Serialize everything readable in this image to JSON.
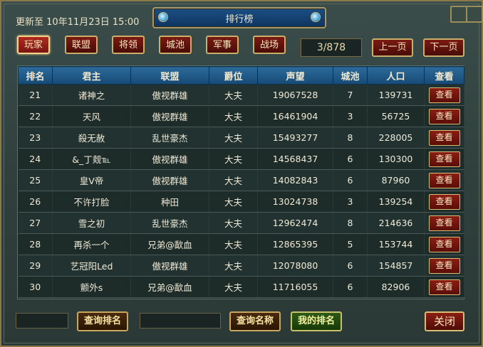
{
  "header": {
    "update_label": "更新至",
    "update_time": "10年11月23日  15:00",
    "title": "排行榜"
  },
  "categories": [
    {
      "label": "玩家",
      "active": true
    },
    {
      "label": "联盟",
      "active": false
    },
    {
      "label": "将领",
      "active": false
    },
    {
      "label": "城池",
      "active": false
    },
    {
      "label": "军事",
      "active": false
    },
    {
      "label": "战场",
      "active": false
    }
  ],
  "pagination": {
    "page_text": "3/878",
    "prev_label": "上一页",
    "next_label": "下一页"
  },
  "table": {
    "columns": [
      "排名",
      "君主",
      "联盟",
      "爵位",
      "声望",
      "城池",
      "人口",
      "查看"
    ],
    "view_label": "查看",
    "rows": [
      {
        "rank": "21",
        "lord": "诸神之",
        "alliance": "傲视群雄",
        "title": "大夫",
        "prestige": "19067528",
        "cities": "7",
        "population": "139731"
      },
      {
        "rank": "22",
        "lord": "天风",
        "alliance": "傲视群雄",
        "title": "大夫",
        "prestige": "16461904",
        "cities": "3",
        "population": "56725"
      },
      {
        "rank": "23",
        "lord": "殺无赦",
        "alliance": "乱世豪杰",
        "title": "大夫",
        "prestige": "15493277",
        "cities": "8",
        "population": "228005"
      },
      {
        "rank": "24",
        "lord": "&_丁觌℡",
        "alliance": "傲视群雄",
        "title": "大夫",
        "prestige": "14568437",
        "cities": "6",
        "population": "130300"
      },
      {
        "rank": "25",
        "lord": "皇V帝",
        "alliance": "傲视群雄",
        "title": "大夫",
        "prestige": "14082843",
        "cities": "6",
        "population": "87960"
      },
      {
        "rank": "26",
        "lord": "不许打脸",
        "alliance": "种田",
        "title": "大夫",
        "prestige": "13024738",
        "cities": "3",
        "population": "139254"
      },
      {
        "rank": "27",
        "lord": "雪之初",
        "alliance": "乱世豪杰",
        "title": "大夫",
        "prestige": "12962474",
        "cities": "8",
        "population": "214636"
      },
      {
        "rank": "28",
        "lord": "再杀一个",
        "alliance": "兄弟@歃血",
        "title": "大夫",
        "prestige": "12865395",
        "cities": "5",
        "population": "153744"
      },
      {
        "rank": "29",
        "lord": "艺冠阳Led",
        "alliance": "傲视群雄",
        "title": "大夫",
        "prestige": "12078080",
        "cities": "6",
        "population": "154857"
      },
      {
        "rank": "30",
        "lord": "颤外s",
        "alliance": "兄弟@歃血",
        "title": "大夫",
        "prestige": "11716055",
        "cities": "6",
        "population": "82906"
      }
    ]
  },
  "footer": {
    "rank_search_value": "",
    "rank_search_button": "查询排名",
    "name_search_value": "",
    "name_search_button": "查询名称",
    "my_rank_button": "我的排名",
    "close_button": "关闭"
  },
  "colors": {
    "panel_bg": "#2f403d",
    "header_blue": "#164a76",
    "button_red": "#7a1a12",
    "gold_border": "#c9b06a"
  }
}
